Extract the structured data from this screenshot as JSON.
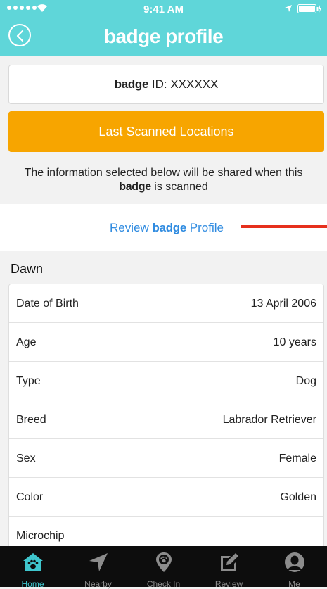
{
  "status_bar": {
    "time": "9:41 AM"
  },
  "header": {
    "title": "badge profile"
  },
  "badge_id": {
    "brand": "badge",
    "label": " ID: XXXXXX"
  },
  "last_scanned_button": {
    "label": "Last Scanned Locations"
  },
  "info_note": {
    "line1": "The information selected below will be shared when this",
    "brand": "badge",
    "line2_suffix": " is scanned"
  },
  "review_link": {
    "prefix": "Review ",
    "brand": "badge",
    "suffix": " Profile"
  },
  "pet": {
    "name": "Dawn",
    "details": [
      {
        "label": "Date of Birth",
        "value": "13 April 2006"
      },
      {
        "label": "Age",
        "value": "10 years"
      },
      {
        "label": "Type",
        "value": "Dog"
      },
      {
        "label": "Breed",
        "value": "Labrador Retriever"
      },
      {
        "label": "Sex",
        "value": "Female"
      },
      {
        "label": "Color",
        "value": "Golden"
      },
      {
        "label": "Microchip",
        "value": ""
      }
    ]
  },
  "tab_bar": {
    "tabs": [
      {
        "label": "Home",
        "icon": "home-paw-icon",
        "active": true
      },
      {
        "label": "Nearby",
        "icon": "location-arrow-icon",
        "active": false
      },
      {
        "label": "Check In",
        "icon": "map-pin-paw-icon",
        "active": false
      },
      {
        "label": "Review",
        "icon": "edit-icon",
        "active": false
      },
      {
        "label": "Me",
        "icon": "person-icon",
        "active": false
      }
    ]
  },
  "colors": {
    "header": "#5fd6d9",
    "accent_orange": "#f7a500",
    "link_blue": "#2f8be0",
    "annotation_red": "#e6301d",
    "tab_active": "#3fc6cd",
    "tab_bar_bg": "#0d0d0d"
  }
}
